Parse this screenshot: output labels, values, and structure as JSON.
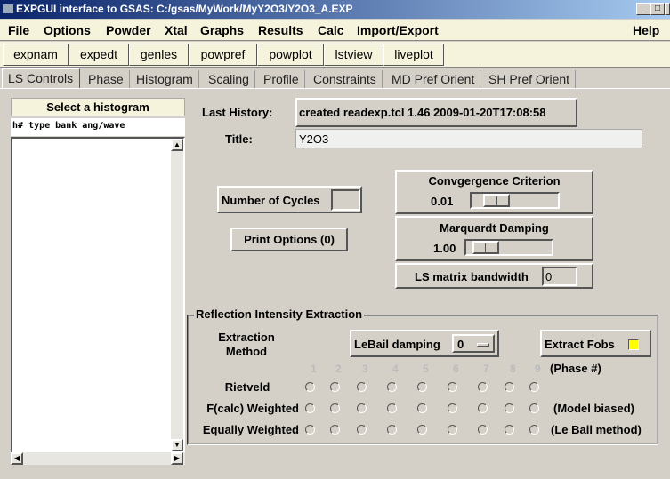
{
  "window": {
    "title": "EXPGUI interface to GSAS: C:/gsas/MyWork/MyY2O3/Y2O3_A.EXP",
    "minimize": "_",
    "maximize": "□",
    "close": "X"
  },
  "menus": [
    "File",
    "Options",
    "Powder",
    "Xtal",
    "Graphs",
    "Results",
    "Calc",
    "Import/Export"
  ],
  "help": "Help",
  "toolbar": [
    "expnam",
    "expedt",
    "genles",
    "powpref",
    "powplot",
    "lstview",
    "liveplot"
  ],
  "tabs": [
    "LS Controls",
    "Phase",
    "Histogram",
    "Scaling",
    "Profile",
    "Constraints",
    "MD Pref Orient",
    "SH Pref Orient"
  ],
  "histogram": {
    "header": "Select a histogram",
    "columns": "h# type bank ang/wave"
  },
  "ls": {
    "last_history_label": "Last History:",
    "last_history": "created readexp.tcl 1.46 2009-01-20T17:08:58",
    "title_label": "Title:",
    "title": "Y2O3",
    "cycles_label": "Number of Cycles",
    "cycles": "",
    "print_options": "Print Options (0)",
    "convergence_label": "Convgergence Criterion",
    "convergence": "0.01",
    "convergence_fraction": 0.2,
    "marquardt_label": "Marquardt Damping",
    "marquardt": "1.00",
    "marquardt_fraction": 0.1,
    "bandwidth_label": "LS matrix bandwidth",
    "bandwidth": "0"
  },
  "extraction": {
    "group_label": "Reflection Intensity Extraction",
    "method_label": "Extraction Method",
    "lebail_label": "LeBail damping",
    "lebail_value": "0",
    "extract_fobs": "Extract Fobs",
    "extract_fobs_color": "#ffff00",
    "phases": [
      "1",
      "2",
      "3",
      "4",
      "5",
      "6",
      "7",
      "8",
      "9"
    ],
    "phase_note": "(Phase #)",
    "rows": [
      {
        "label": "Rietveld",
        "note": ""
      },
      {
        "label": "F(calc) Weighted",
        "note": "(Model biased)"
      },
      {
        "label": "Equally Weighted",
        "note": "(Le Bail method)"
      }
    ]
  }
}
